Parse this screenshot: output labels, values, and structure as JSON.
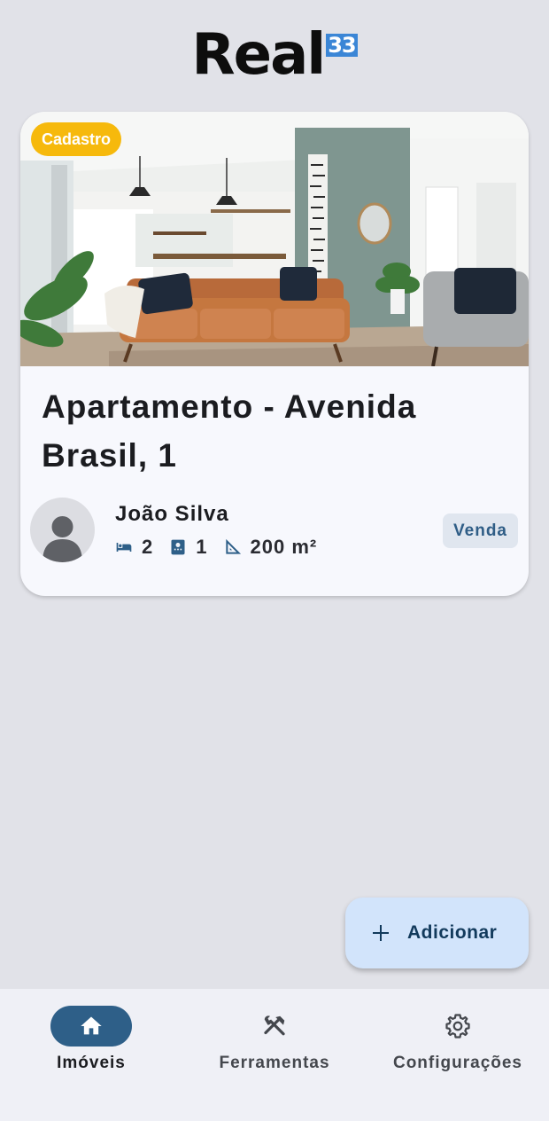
{
  "header": {
    "logo_text": "Real",
    "logo_badge": "33"
  },
  "listing": {
    "status_badge": "Cadastro",
    "title": "Apartamento - Avenida Brasil, 1",
    "owner_name": "João Silva",
    "bedrooms": "2",
    "bathrooms": "1",
    "area": "200 m²",
    "type_tag": "Venda",
    "icons": [
      "bed-icon",
      "bathroom-icon",
      "area-icon"
    ]
  },
  "fab": {
    "label": "Adicionar",
    "icon": "plus-icon"
  },
  "bottom_nav": {
    "items": [
      {
        "label": "Imóveis",
        "icon": "home-icon",
        "active": true
      },
      {
        "label": "Ferramentas",
        "icon": "tools-icon",
        "active": false
      },
      {
        "label": "Configurações",
        "icon": "gear-icon",
        "active": false
      }
    ]
  },
  "colors": {
    "background": "#e1e2e8",
    "card": "#f7f8fd",
    "badge": "#f6b90c",
    "primary": "#2e5f88",
    "fab": "#d2e4fb",
    "logo_badge": "#3b86d6"
  }
}
